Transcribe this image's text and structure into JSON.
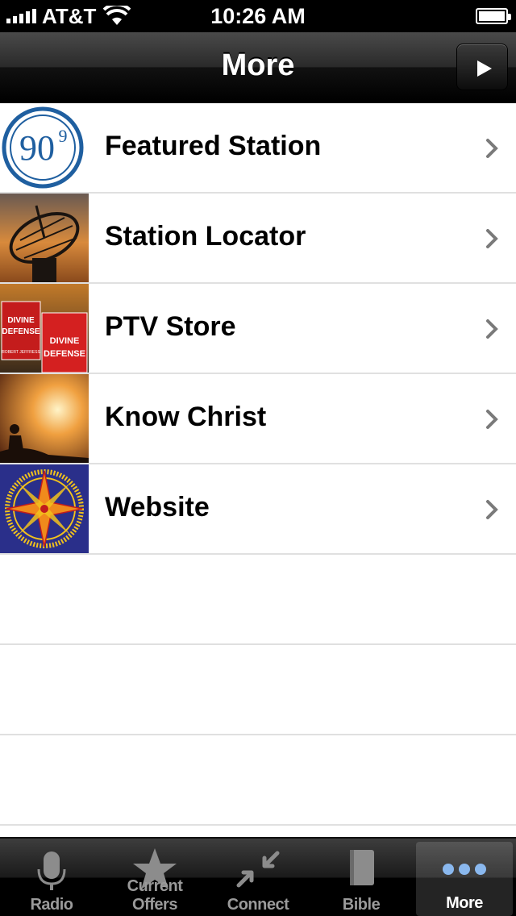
{
  "status_bar": {
    "carrier": "AT&T",
    "time": "10:26 AM"
  },
  "nav": {
    "title": "More"
  },
  "list": {
    "items": [
      {
        "label": "Featured Station",
        "icon": "radio-909-logo"
      },
      {
        "label": "Station Locator",
        "icon": "satellite-dish-image"
      },
      {
        "label": "PTV Store",
        "icon": "book-cover-image"
      },
      {
        "label": "Know Christ",
        "icon": "sunset-silhouette-image"
      },
      {
        "label": "Website",
        "icon": "compass-star-image"
      }
    ]
  },
  "tabs": [
    {
      "label": "Radio",
      "icon": "microphone-icon"
    },
    {
      "label": "Current Offers",
      "icon": "star-icon"
    },
    {
      "label": "Connect",
      "icon": "arrows-inward-icon"
    },
    {
      "label": "Bible",
      "icon": "book-icon"
    },
    {
      "label": "More",
      "icon": "more-dots-icon",
      "active": true
    }
  ],
  "thumbnails": {
    "logo_text": "90",
    "logo_superscript": "9",
    "book_word_1": "DIVINE",
    "book_word_2": "DEFENSE",
    "book_author": "ROBERT JEFFRESS"
  },
  "colors": {
    "logo_blue": "#1f5fa0",
    "active_dot_blue": "#8ab8ee",
    "compass_bg": "#2a2f8a"
  }
}
